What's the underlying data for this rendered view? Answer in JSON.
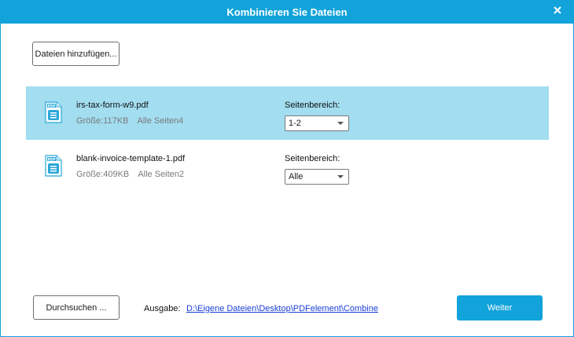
{
  "window": {
    "title": "Kombinieren Sie Dateien",
    "accent_color": "#11a3d9",
    "selected_row_color": "#a2ddf0"
  },
  "toolbar": {
    "add_files_label": "Dateien hinzufügen..."
  },
  "files": [
    {
      "name": "irs-tax-form-w9.pdf",
      "size": "Größe:117KB",
      "pages": "Alle Seiten4",
      "range_label": "Seitenbereich:",
      "range_value": "1-2",
      "selected": true,
      "icon": "pdf-file-icon"
    },
    {
      "name": "blank-invoice-template-1.pdf",
      "size": "Größe:409KB",
      "pages": "Alle Seiten2",
      "range_label": "Seitenbereich:",
      "range_value": "Alle",
      "selected": false,
      "icon": "pdf-file-icon"
    }
  ],
  "footer": {
    "browse_label": "Durchsuchen ...",
    "output_label": "Ausgabe:",
    "output_path": "D:\\Eigene Dateien\\Desktop\\PDFelement\\Combine",
    "next_label": "Weiter"
  }
}
